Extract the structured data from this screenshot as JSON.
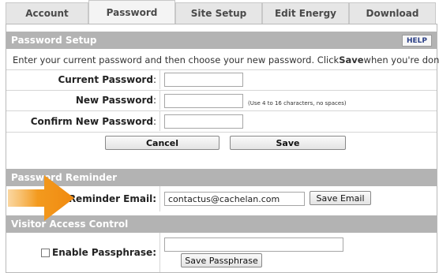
{
  "tabs": [
    {
      "label": "Account",
      "active": false
    },
    {
      "label": "Password",
      "active": true
    },
    {
      "label": "Site Setup",
      "active": false
    },
    {
      "label": "Edit Energy",
      "active": false
    },
    {
      "label": "Download",
      "active": false
    }
  ],
  "password_setup": {
    "header": "Password Setup",
    "help_label": "HELP",
    "intro_pre": "Enter your current password and then choose your new password. Click ",
    "intro_bold": "Save",
    "intro_post": " when you're done.",
    "current_label": "Current Password",
    "new_label": "New Password",
    "confirm_label": "Confirm New Password",
    "colon": ":",
    "new_hint": "(Use 4 to 16 characters, no spaces)",
    "current_value": "",
    "new_value": "",
    "confirm_value": "",
    "cancel_label": "Cancel",
    "save_label": "Save"
  },
  "password_reminder": {
    "header": "Password Reminder",
    "email_label": "Reminder Email:",
    "email_value": "contactus@cachelan.com",
    "save_email_label": "Save Email"
  },
  "visitor_access": {
    "header": "Visitor Access Control",
    "passphrase_label": "Enable Passphrase:",
    "passphrase_enabled": false,
    "passphrase_value": "",
    "save_passphrase_label": "Save Passphrase"
  },
  "colors": {
    "header_bg": "#b3b3b3",
    "arrow": "#f39a1e",
    "help_text": "#2b3f86"
  }
}
